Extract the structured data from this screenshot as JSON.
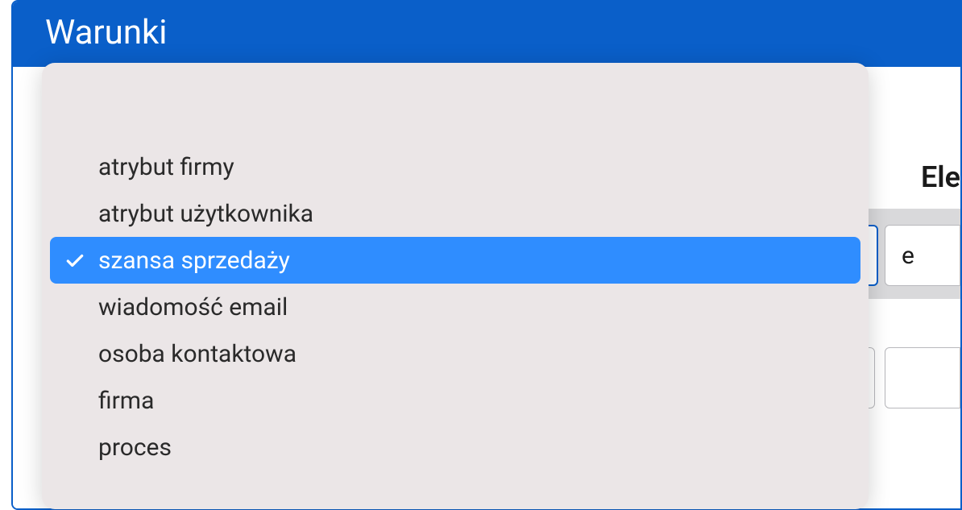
{
  "panel": {
    "title": "Warunki"
  },
  "right": {
    "label_partial": "Ele",
    "truncated_value": "e"
  },
  "dropdown": {
    "items": [
      {
        "label": "atrybut firmy",
        "selected": false
      },
      {
        "label": "atrybut użytkownika",
        "selected": false
      },
      {
        "label": "szansa sprzedaży",
        "selected": true
      },
      {
        "label": "wiadomość email",
        "selected": false
      },
      {
        "label": "osoba kontaktowa",
        "selected": false
      },
      {
        "label": "firma",
        "selected": false
      },
      {
        "label": "proces",
        "selected": false
      }
    ]
  },
  "colors": {
    "primary": "#0a5fc9",
    "highlight": "#2f8dff",
    "dropdownBg": "#ebe6e7"
  }
}
